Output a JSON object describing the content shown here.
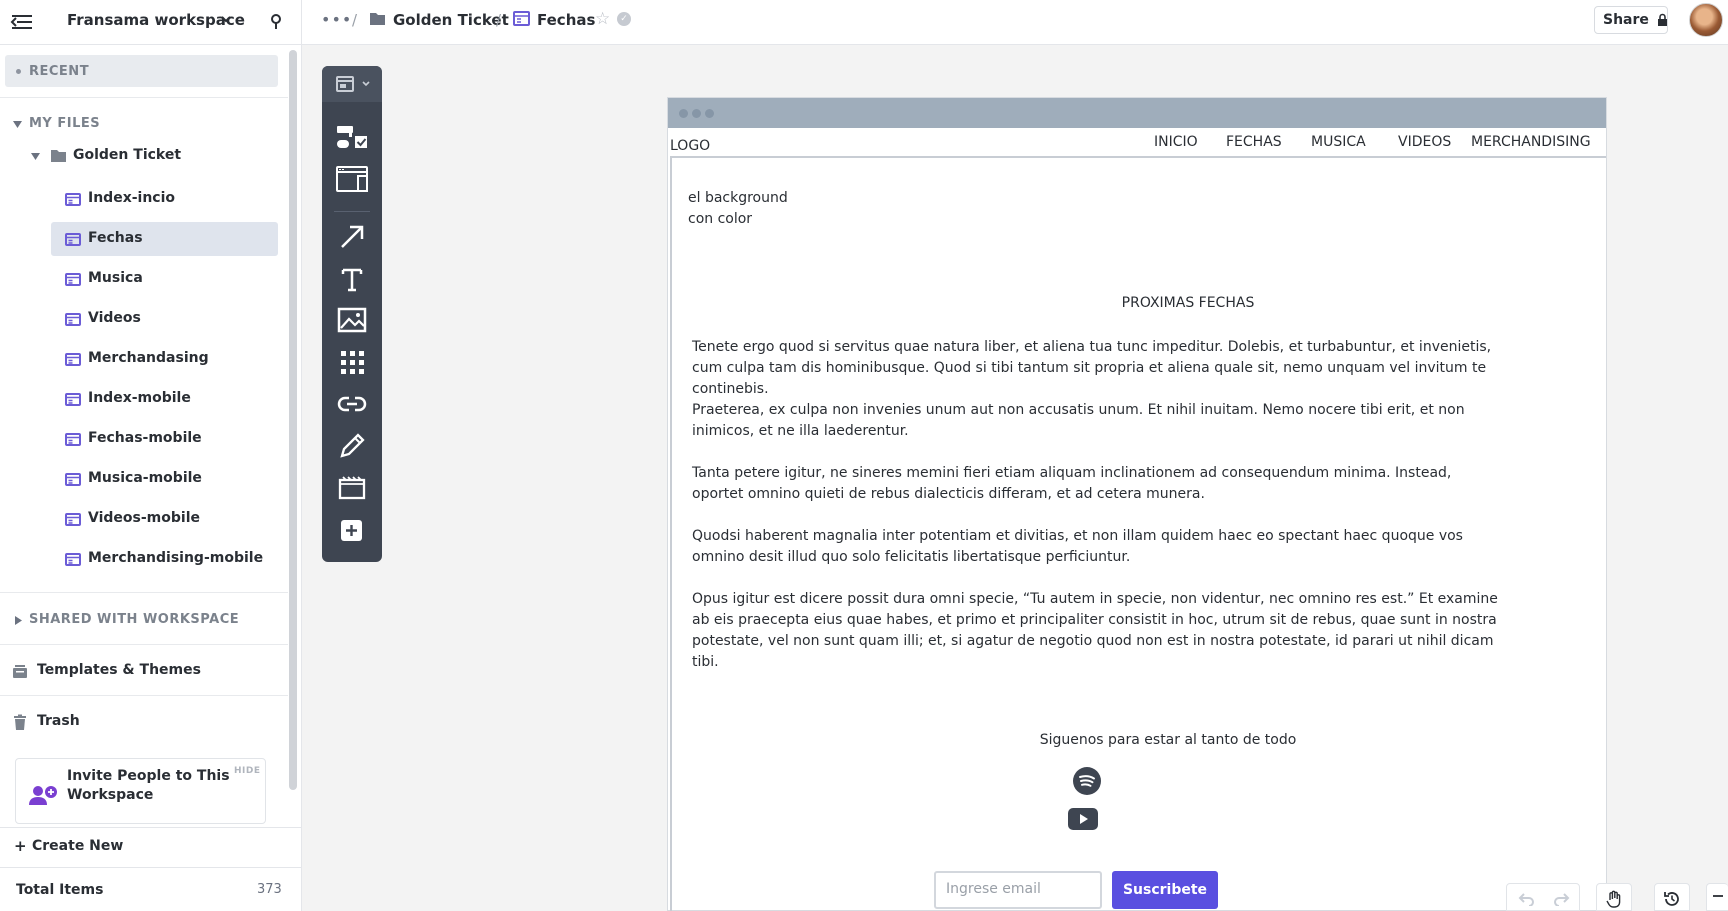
{
  "topbar": {
    "workspace_name": "Fransama workspace",
    "more": "•••",
    "crumb_sep": "/",
    "folder": "Golden Ticket",
    "page": "Fechas",
    "share_label": "Share"
  },
  "sidebar": {
    "recent_label": "RECENT",
    "my_files_label": "MY FILES",
    "folder_label": "Golden Ticket",
    "pages": [
      {
        "label": "Index-incio"
      },
      {
        "label": "Fechas"
      },
      {
        "label": "Musica"
      },
      {
        "label": "Videos"
      },
      {
        "label": "Merchandasing"
      },
      {
        "label": "Index-mobile"
      },
      {
        "label": "Fechas-mobile"
      },
      {
        "label": "Musica-mobile"
      },
      {
        "label": "Videos-mobile"
      },
      {
        "label": "Merchandising-mobile"
      }
    ],
    "active_page": "Fechas",
    "shared_label": "SHARED WITH WORKSPACE",
    "templates_label": "Templates & Themes",
    "trash_label": "Trash",
    "invite_text": "Invite People to This Workspace",
    "invite_hide": "HIDE",
    "create_plus": "+",
    "create_label": "Create New",
    "total_label": "Total Items",
    "total_count": "373"
  },
  "wireframe": {
    "logo": "LOGO",
    "nav": [
      "INICIO",
      "FECHAS",
      "MUSICA",
      "VIDEOS",
      "MERCHANDISING"
    ],
    "note_line1": "el background",
    "note_line2": "con color",
    "title": "PROXIMAS FECHAS",
    "paragraphs": [
      "Tenete ergo quod si servitus quae natura liber, et aliena tua tunc impeditur. Dolebis, et turbabuntur, et invenietis, cum culpa tam dis hominibusque. Quod si tibi tantum sit propria et aliena quale sit, nemo unquam vel invitum te continebis.",
      "Praeterea, ex culpa non invenies unum aut non accusatis unum. Et nihil inuitam. Nemo nocere tibi erit, et non inimicos, et ne illa laederentur.",
      "Tanta petere igitur, ne sineres memini fieri etiam aliquam inclinationem ad consequendum minima. Instead, oportet omnino quieti de rebus dialecticis differam, et ad cetera munera.",
      "Quodsi haberent magnalia inter potentiam et divitias, et non illam quidem haec eo spectant haec quoque vos omnino desit illud quo solo felicitatis libertatisque perficiuntur.",
      "Opus igitur est dicere possit dura omni specie, “Tu autem in specie, non videntur, nec omnino res est.” Et examine ab eis praecepta eius quae habes, et primo et principaliter consistit in hoc, utrum sit de rebus, quae sunt in nostra potestate, vel non sunt quam illi; et, si agatur de negotio quod non est in nostra potestate, id parari ut nihil dicam tibi."
    ],
    "follow_text": "Siguenos para estar al tanto de todo",
    "email_placeholder": "Ingrese email",
    "subscribe_label": "Suscribete"
  },
  "colors": {
    "accent": "#5a4fe0",
    "page_icon": "#6b5cd6",
    "toolbar_bg": "#3e4551",
    "frame_bar": "#9fadbb"
  }
}
